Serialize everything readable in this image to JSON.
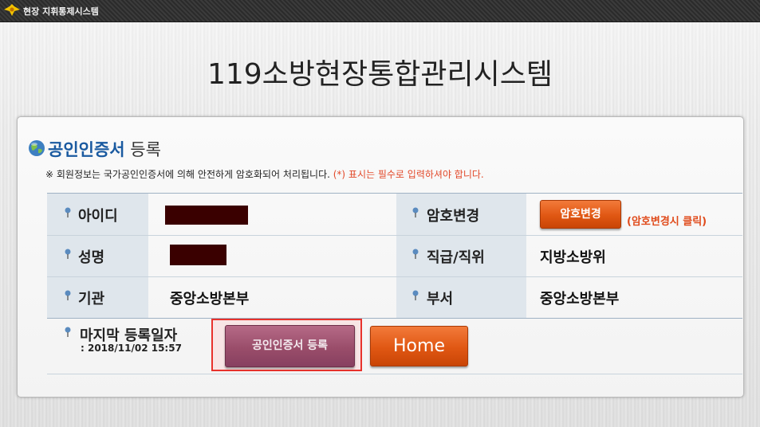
{
  "topbar": {
    "title": "현장 지휘통제시스템",
    "logo_icon": "firefighter-emblem-icon"
  },
  "main_title": "119소방현장통합관리시스템",
  "section": {
    "title_bold": "공인인증서",
    "title_normal": " 등록",
    "notice_prefix": "※ 회원정보는 국가공인인증서에 의해 안전하게 암호화되어 처리됩니다. ",
    "notice_required": "(*) 표시는 필수로 입력하셔야 합니다."
  },
  "fields": {
    "id_label": "아이디",
    "name_label": "성명",
    "org_label": "기관",
    "org_value": "중앙소방본부",
    "pw_label": "암호변경",
    "pw_button": "암호변경",
    "pw_hint": "(암호변경시 클릭)",
    "rank_label": "직급/직위",
    "rank_value": "지방소방위",
    "dept_label": "부서",
    "dept_value": "중앙소방본부"
  },
  "footer": {
    "last_label": "마지막 등록일자",
    "last_date": ": 2018/11/02 15:57",
    "cert_button": "공인인증서 등록",
    "home_button": "Home"
  },
  "colors": {
    "accent_orange": "#e05713",
    "title_blue": "#1a5aa0",
    "required_red": "#e2492a",
    "highlight_red": "#e8322c"
  }
}
